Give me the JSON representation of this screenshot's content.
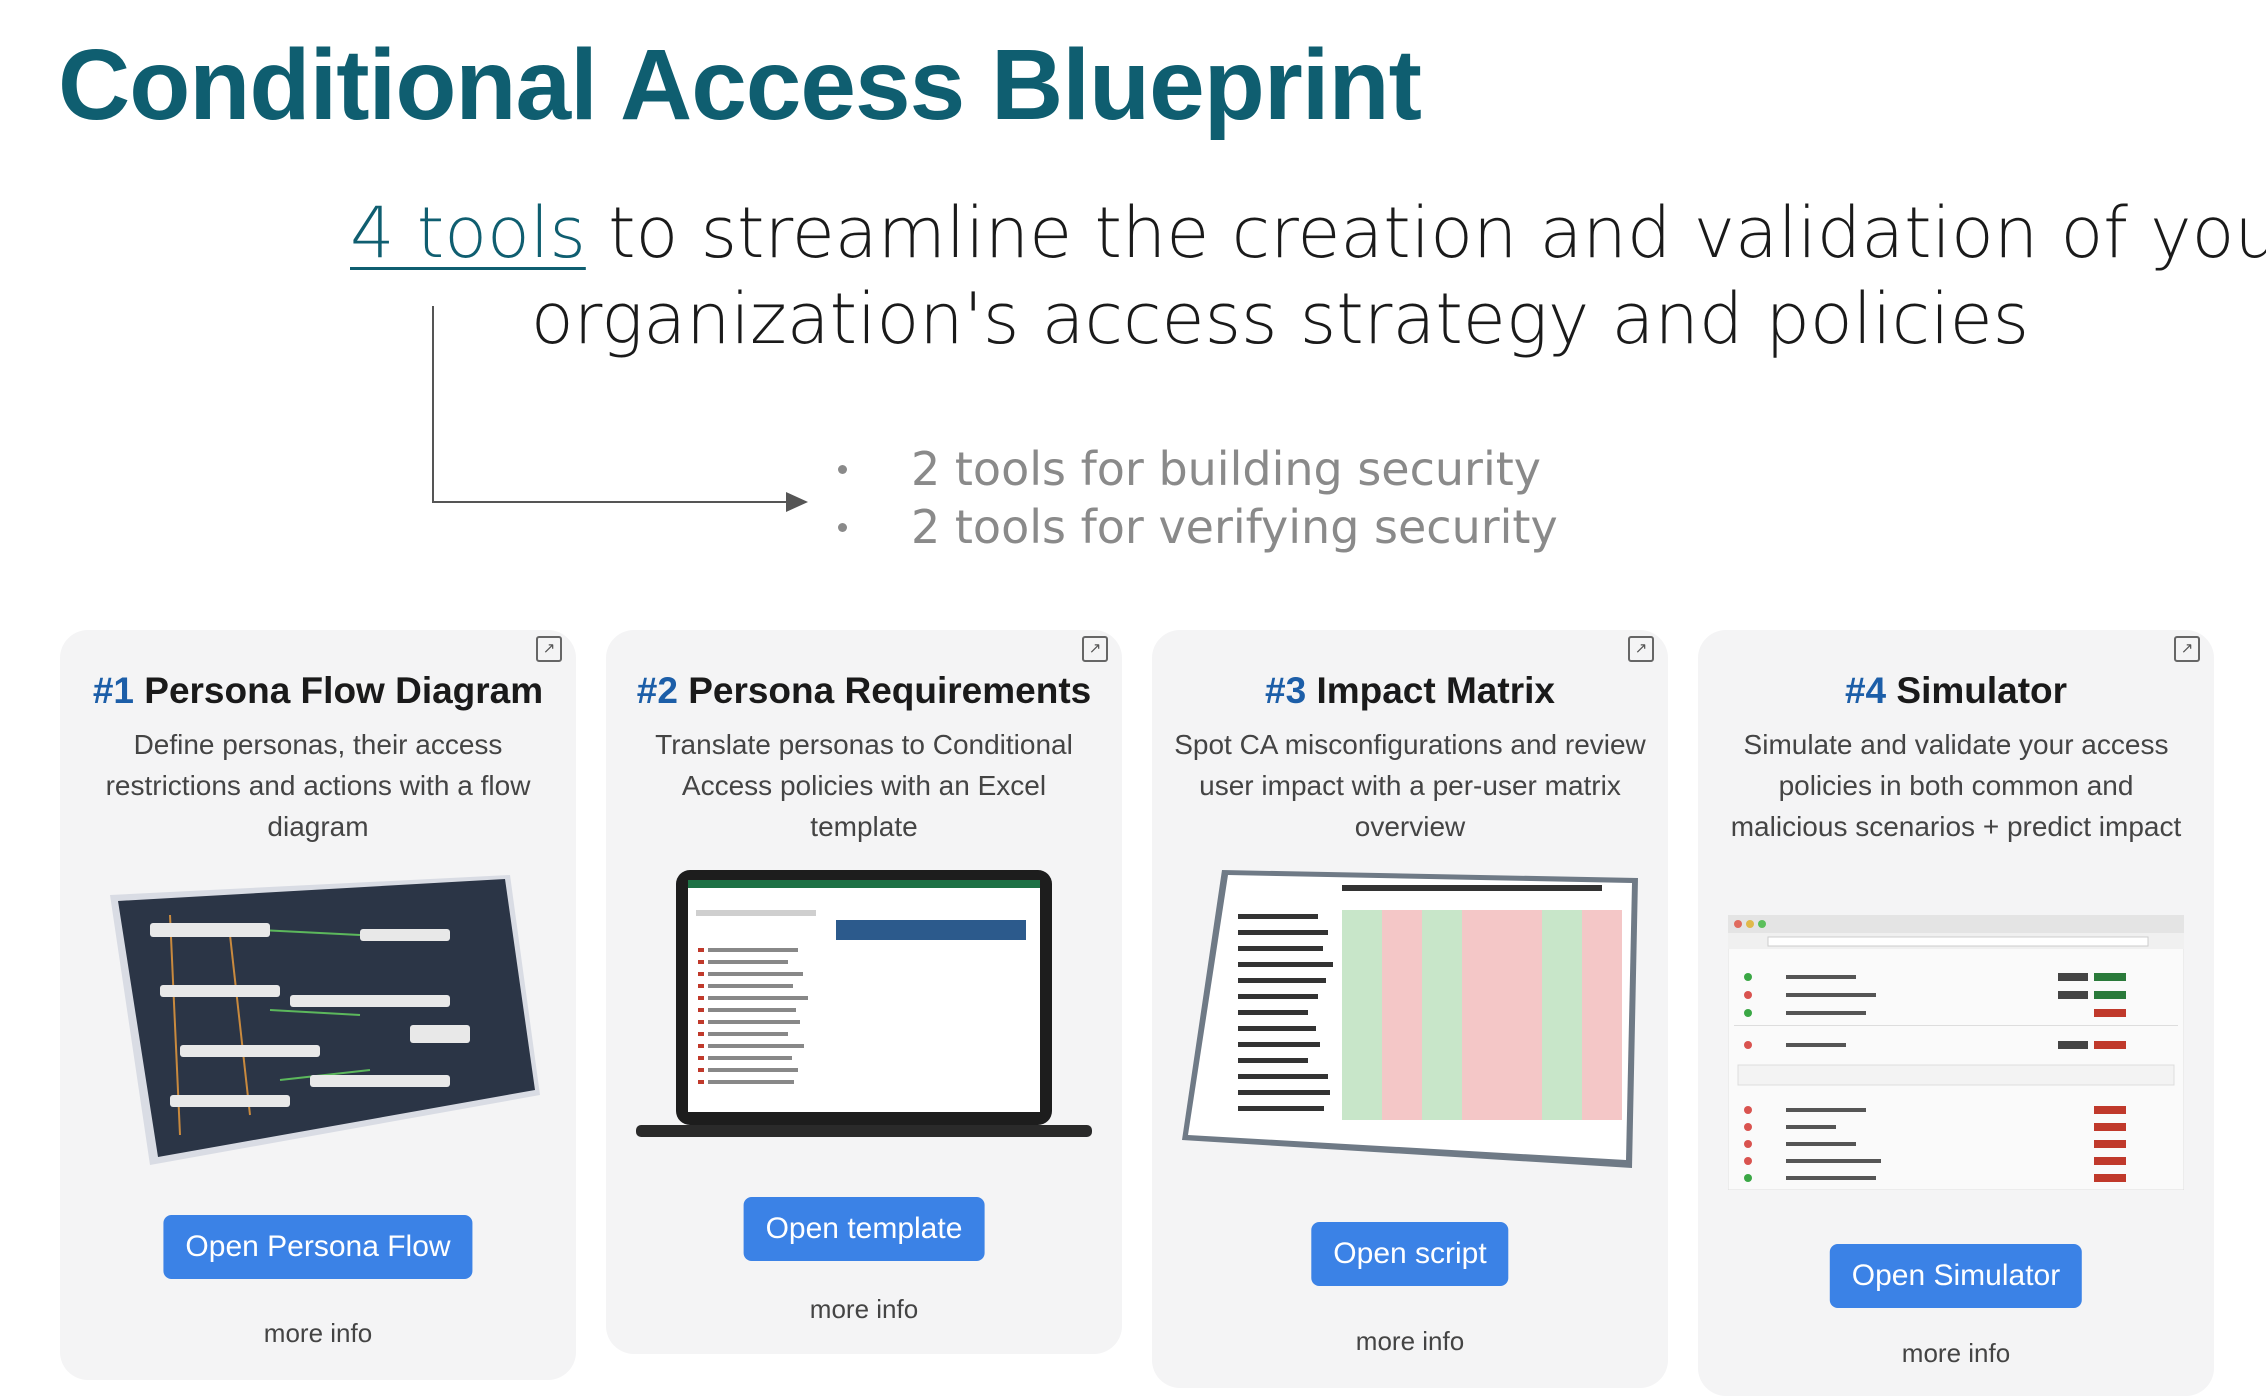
{
  "page": {
    "title": "Conditional Access Blueprint",
    "subtitle_link": "4 tools",
    "subtitle_rest_1": " to streamline the creation and validation of your",
    "subtitle_line_2": "organization's access strategy and policies",
    "bullets": [
      "2 tools for building security",
      "2 tools for verifying security"
    ]
  },
  "colors": {
    "title": "#0f5e70",
    "accent_number": "#1c5ea8",
    "button": "#3b82e6",
    "card_bg": "#f4f4f5"
  },
  "cards": [
    {
      "number": "#1",
      "title": "Persona Flow Diagram",
      "description": "Define personas, their access restrictions and actions with a flow diagram",
      "button": "Open Persona Flow",
      "more": "more info",
      "icon": "external-link-icon",
      "image": "flow-diagram-preview"
    },
    {
      "number": "#2",
      "title": "Persona Requirements",
      "description": "Translate personas to Conditional Access policies with an Excel template",
      "button": "Open template",
      "more": "more info",
      "icon": "external-link-icon",
      "image": "excel-template-preview"
    },
    {
      "number": "#3",
      "title": "Impact Matrix",
      "description": "Spot CA misconfigurations and review user impact with a per-user matrix overview",
      "button": "Open script",
      "more": "more info",
      "icon": "external-link-icon",
      "image": "impact-matrix-preview"
    },
    {
      "number": "#4",
      "title": "Simulator",
      "description": "Simulate and validate your access policies in both common and malicious scenarios + predict impact",
      "button": "Open Simulator",
      "more": "more info",
      "icon": "external-link-icon",
      "image": "simulator-preview"
    }
  ]
}
